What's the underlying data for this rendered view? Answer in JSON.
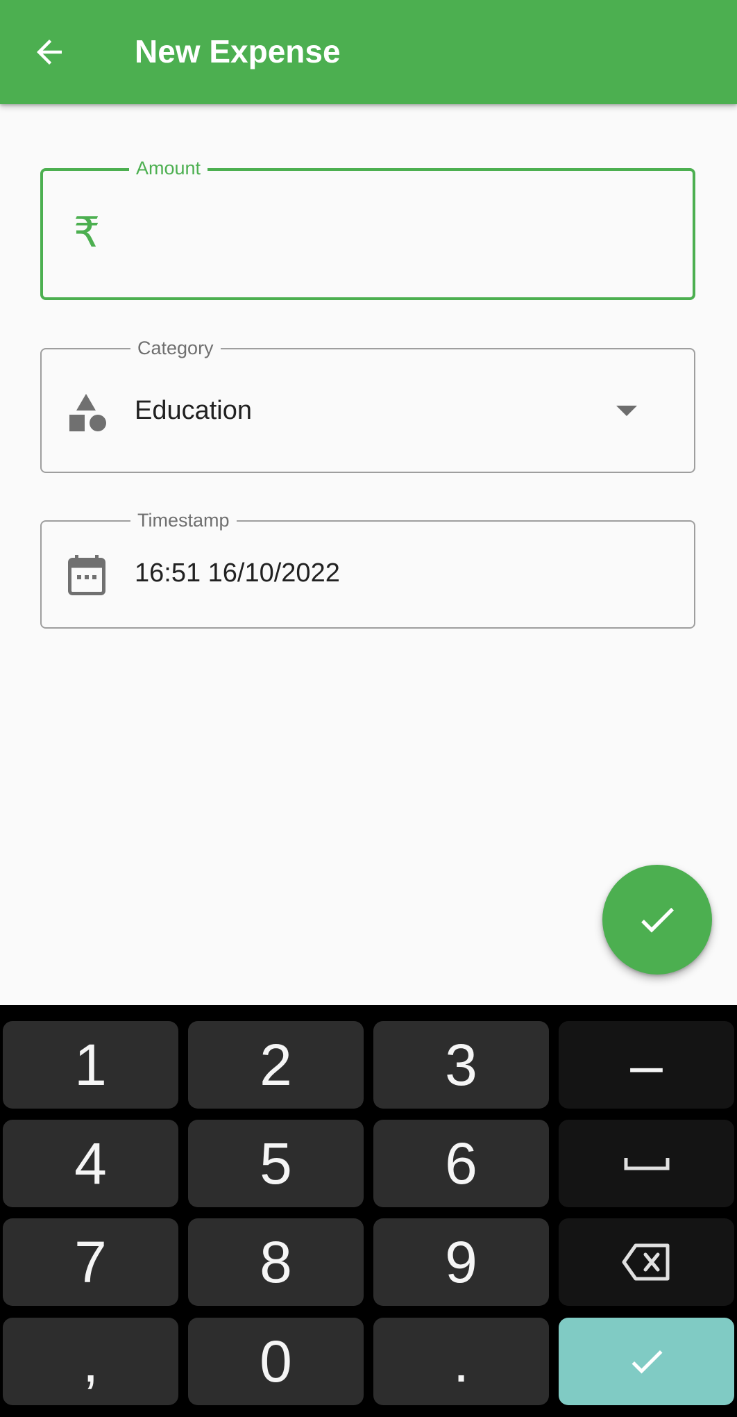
{
  "app_bar": {
    "title": "New Expense",
    "back_icon": "arrow-back-icon",
    "background_color": "#4caf50"
  },
  "amount_field": {
    "label": "Amount",
    "prefix": "₹",
    "value": "",
    "accent_color": "#4caf50"
  },
  "category_field": {
    "label": "Category",
    "value": "Education",
    "icon": "category-shapes-icon",
    "dropdown_icon": "arrow-drop-down-icon"
  },
  "timestamp_field": {
    "label": "Timestamp",
    "value": "16:51 16/10/2022",
    "icon": "calendar-icon"
  },
  "fab": {
    "icon": "check-icon",
    "color": "#4caf50"
  },
  "keyboard": {
    "keys": {
      "k1": "1",
      "k2": "2",
      "k3": "3",
      "minus": "–",
      "k4": "4",
      "k5": "5",
      "k6": "6",
      "space": "space-bar-icon",
      "k7": "7",
      "k8": "8",
      "k9": "9",
      "backspace": "backspace-icon",
      "comma": ",",
      "k0": "0",
      "period": ".",
      "enter": "check-icon"
    },
    "enter_color": "#80cbc4"
  }
}
